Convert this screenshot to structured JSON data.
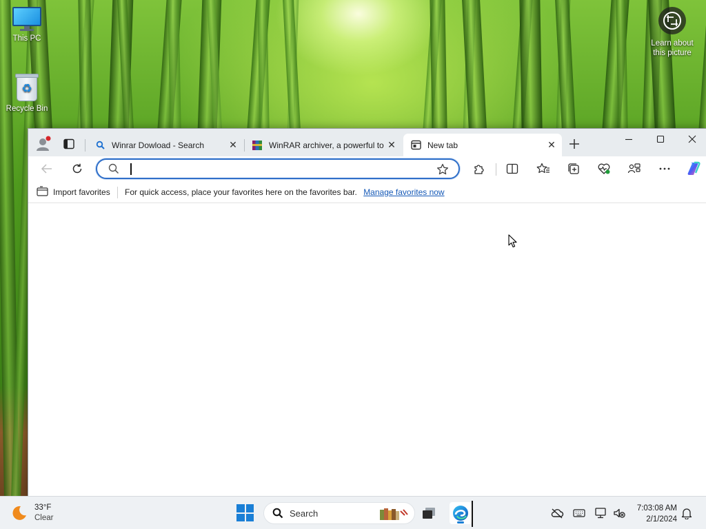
{
  "desktop": {
    "icons": [
      {
        "label": "This PC",
        "icon": "computer-icon"
      },
      {
        "label": "Recycle Bin",
        "icon": "recycle-bin-icon"
      }
    ],
    "learn_picture": {
      "line1": "Learn about",
      "line2": "this picture",
      "icon": "camera-circle-icon"
    }
  },
  "browser": {
    "tabs": [
      {
        "label": "Winrar Dowload - Search",
        "icon": "search-icon",
        "active": false
      },
      {
        "label": "WinRAR archiver, a powerful to",
        "icon": "winrar-icon",
        "active": false
      },
      {
        "label": "New tab",
        "icon": "new-tab-icon",
        "active": true
      }
    ],
    "address_bar": {
      "value": "",
      "placeholder": ""
    },
    "favorites_bar": {
      "import_label": "Import favorites",
      "message": "For quick access, place your favorites here on the favorites bar.",
      "link_label": "Manage favorites now"
    },
    "colors": {
      "accent": "#2f6fc9",
      "link": "#1559b7",
      "titlebar": "#e8ecef"
    }
  },
  "taskbar": {
    "weather": {
      "temperature": "33°F",
      "condition": "Clear",
      "icon": "moon-icon"
    },
    "search_label": "Search",
    "clock": {
      "time": "7:03:08 AM",
      "date": "2/1/2024"
    }
  }
}
